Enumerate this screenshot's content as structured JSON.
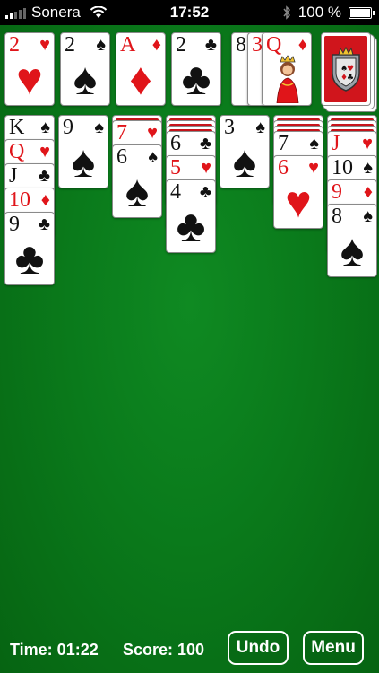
{
  "statusbar": {
    "carrier": "Sonera",
    "time": "17:52",
    "battery": "100 %"
  },
  "colors": {
    "felt": "#0a7a1b",
    "card_red": "#e0151a",
    "card_black": "#111111",
    "card_back": "#c8141b"
  },
  "foundations": [
    {
      "rank": "2",
      "suit": "♥",
      "color": "red"
    },
    {
      "rank": "2",
      "suit": "♠",
      "color": "black"
    },
    {
      "rank": "A",
      "suit": "♦",
      "color": "red"
    },
    {
      "rank": "2",
      "suit": "♣",
      "color": "black"
    }
  ],
  "waste": [
    {
      "rank": "8",
      "suit": "",
      "color": "black"
    },
    {
      "rank": "3",
      "suit": "",
      "color": "red"
    },
    {
      "rank": "Q",
      "suit": "♦",
      "color": "red"
    }
  ],
  "tableau": [
    {
      "facedown": 0,
      "cards": [
        {
          "rank": "K",
          "suit": "♠",
          "color": "black"
        },
        {
          "rank": "Q",
          "suit": "♥",
          "color": "red"
        },
        {
          "rank": "J",
          "suit": "♣",
          "color": "black"
        },
        {
          "rank": "10",
          "suit": "♦",
          "color": "red"
        },
        {
          "rank": "9",
          "suit": "♣",
          "color": "black"
        }
      ]
    },
    {
      "facedown": 0,
      "cards": [
        {
          "rank": "9",
          "suit": "♠",
          "color": "black"
        }
      ]
    },
    {
      "facedown": 1,
      "cards": [
        {
          "rank": "7",
          "suit": "♥",
          "color": "red"
        },
        {
          "rank": "6",
          "suit": "♠",
          "color": "black"
        }
      ]
    },
    {
      "facedown": 3,
      "cards": [
        {
          "rank": "6",
          "suit": "♣",
          "color": "black"
        },
        {
          "rank": "5",
          "suit": "♥",
          "color": "red"
        },
        {
          "rank": "4",
          "suit": "♣",
          "color": "black"
        }
      ]
    },
    {
      "facedown": 0,
      "cards": [
        {
          "rank": "3",
          "suit": "♠",
          "color": "black"
        }
      ]
    },
    {
      "facedown": 3,
      "cards": [
        {
          "rank": "7",
          "suit": "♠",
          "color": "black"
        },
        {
          "rank": "6",
          "suit": "♥",
          "color": "red"
        }
      ]
    },
    {
      "facedown": 3,
      "cards": [
        {
          "rank": "J",
          "suit": "♥",
          "color": "red"
        },
        {
          "rank": "10",
          "suit": "♠",
          "color": "black"
        },
        {
          "rank": "9",
          "suit": "♦",
          "color": "red"
        },
        {
          "rank": "8",
          "suit": "♠",
          "color": "black"
        }
      ]
    }
  ],
  "bottombar": {
    "time_label": "Time: 01:22",
    "score_label": "Score: 100",
    "undo_label": "Undo",
    "menu_label": "Menu"
  }
}
